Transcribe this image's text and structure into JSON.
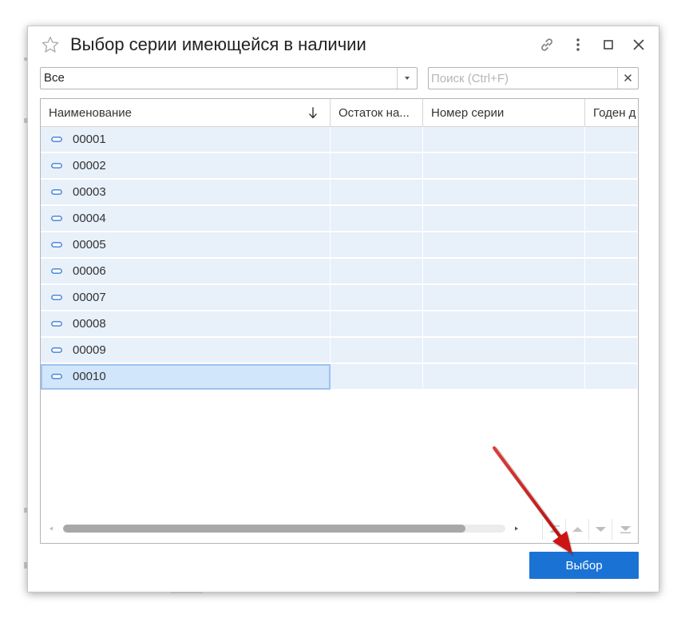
{
  "dialog": {
    "title": "Выбор серии имеющейся в наличии",
    "icons": {
      "favorite": "star-outline-icon",
      "link": "link-icon",
      "menu": "more-vertical-icon",
      "maximize": "maximize-icon",
      "close": "close-icon"
    }
  },
  "filter": {
    "value": "Все",
    "dropdown_icon": "caret-down-icon"
  },
  "search": {
    "placeholder": "Поиск (Ctrl+F)",
    "value": "",
    "clear_icon": "close-icon"
  },
  "table": {
    "columns": [
      {
        "label": "Наименование",
        "sort": "descending"
      },
      {
        "label": "Остаток на..."
      },
      {
        "label": "Номер серии"
      },
      {
        "label": "Годен д"
      }
    ],
    "rows": [
      {
        "name": "00001",
        "selected": false
      },
      {
        "name": "00002",
        "selected": false
      },
      {
        "name": "00003",
        "selected": false
      },
      {
        "name": "00004",
        "selected": false
      },
      {
        "name": "00005",
        "selected": false
      },
      {
        "name": "00006",
        "selected": false
      },
      {
        "name": "00007",
        "selected": false
      },
      {
        "name": "00008",
        "selected": false
      },
      {
        "name": "00009",
        "selected": false
      },
      {
        "name": "00010",
        "selected": true
      }
    ],
    "row_icon": "series-item-icon",
    "scroll_position": 0.91
  },
  "nav": {
    "icons": [
      "scroll-first-icon",
      "scroll-up-icon",
      "scroll-down-icon",
      "scroll-last-icon"
    ]
  },
  "actions": {
    "select_label": "Выбор"
  },
  "colors": {
    "accent": "#1a73d4",
    "row_background": "#e8f0fa",
    "selected_row": "#d2e6fb",
    "annotation_arrow": "#d81e1e"
  }
}
